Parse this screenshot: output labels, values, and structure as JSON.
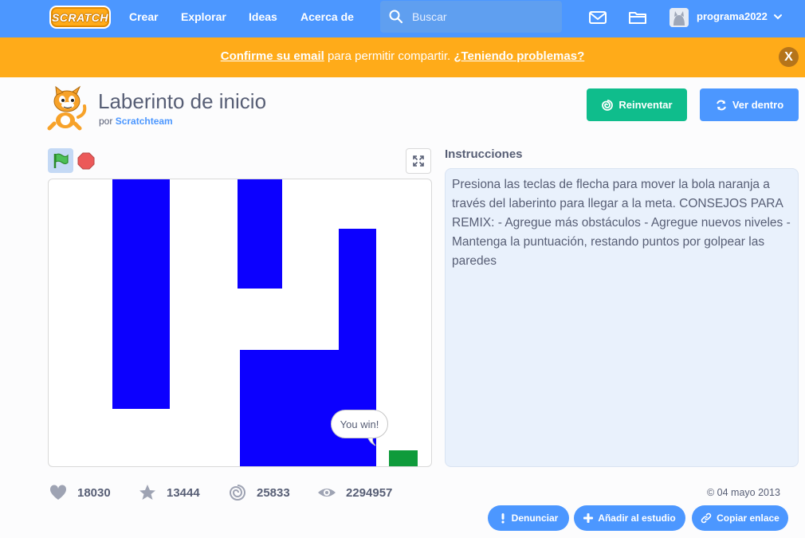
{
  "nav": {
    "logo_text": "SCRATCH",
    "links": [
      "Crear",
      "Explorar",
      "Ideas",
      "Acerca de"
    ],
    "search_placeholder": "Buscar",
    "username": "programa2022",
    "icons": [
      "messages-icon",
      "mystuff-folder-icon",
      "chevron-down-icon"
    ],
    "color": "#4c97ff"
  },
  "banner": {
    "link1": "Confirme su email",
    "middle": " para permitir compartir. ",
    "link2": "¿Teniendo problemas?",
    "close": "X",
    "color": "#ffab19"
  },
  "project": {
    "title": "Laberinto de inicio",
    "by_prefix": "por",
    "author": "Scratchteam",
    "remix_label": "Reinventar",
    "see_inside_label": "Ver dentro"
  },
  "stage": {
    "speech": "You win!",
    "wall_color": "#0c00ff",
    "goal_color": "#0f9b3b"
  },
  "instructions": {
    "label": "Instrucciones",
    "text": "Presiona las teclas de flecha para mover la bola naranja a través del laberinto para llegar a la meta. CONSEJOS PARA REMIX: - Agregue más obstáculos - Agregue nuevos niveles - Mantenga la puntuación, restando puntos por golpear las paredes"
  },
  "stats": {
    "loves": "18030",
    "favorites": "13444",
    "remixes": "25833",
    "views": "2294957",
    "date": "© 04 mayo 2013"
  },
  "actions": {
    "report": "Denunciar",
    "add_to_studio": "Añadir al estudio",
    "copy_link": "Copiar enlace"
  }
}
